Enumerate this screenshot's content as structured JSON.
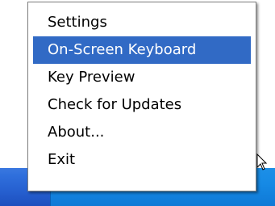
{
  "menu": {
    "items": [
      {
        "label": "Settings",
        "selected": false
      },
      {
        "label": "On-Screen Keyboard",
        "selected": true
      },
      {
        "label": "Key Preview",
        "selected": false
      },
      {
        "label": "Check for Updates",
        "selected": false
      },
      {
        "label": "About...",
        "selected": false
      },
      {
        "label": "Exit",
        "selected": false
      }
    ]
  },
  "tray": {
    "icons": [
      "keyboard-icon",
      "network-icon",
      "volume-icon",
      "shield-icon",
      "security-icon"
    ]
  },
  "colors": {
    "selection": "#316ac5",
    "taskbar": "#2660d0",
    "tray": "#168ae5"
  }
}
